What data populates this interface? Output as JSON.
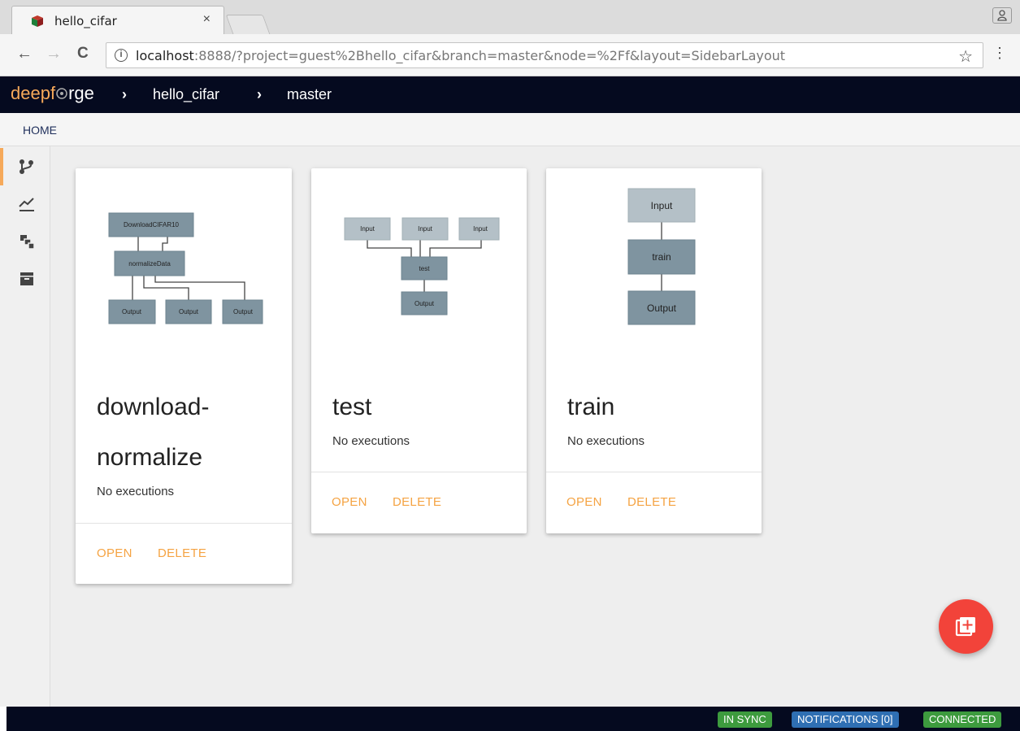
{
  "browser": {
    "tab_title": "hello_cifar",
    "tab_close": "×",
    "profile_icon": "person-icon",
    "url_host": "localhost",
    "url_rest": ":8888/?project=guest%2Bhello_cifar&branch=master&node=%2Ff&layout=SidebarLayout",
    "back": "←",
    "forward": "→",
    "reload": "C",
    "info": "i",
    "star": "☆",
    "menu": "⋮"
  },
  "header": {
    "brand_prefix": "deepf",
    "brand_suffix": "rge",
    "sep": "›",
    "project": "hello_cifar",
    "branch": "master"
  },
  "nav": {
    "home": "HOME"
  },
  "sidebar": {
    "items": [
      {
        "icon": "pipelines-icon",
        "active": true
      },
      {
        "icon": "executions-chart-icon",
        "active": false
      },
      {
        "icon": "layers-icon",
        "active": false
      },
      {
        "icon": "archive-icon",
        "active": false
      }
    ]
  },
  "cards": [
    {
      "title_line1": "download-",
      "title_line2": "normalize",
      "status": "No executions",
      "open": "OPEN",
      "delete": "DELETE",
      "diagram": {
        "top": "DownloadCIFAR10",
        "mid": "normalizeData",
        "out1": "Output",
        "out2": "Output",
        "out3": "Output"
      }
    },
    {
      "title": "test",
      "status": "No executions",
      "open": "OPEN",
      "delete": "DELETE",
      "diagram": {
        "in1": "Input",
        "in2": "Input",
        "in3": "Input",
        "mid": "test",
        "out": "Output"
      }
    },
    {
      "title": "train",
      "status": "No executions",
      "open": "OPEN",
      "delete": "DELETE",
      "diagram": {
        "in": "Input",
        "mid": "train",
        "out": "Output"
      }
    }
  ],
  "footer": {
    "sync": "IN SYNC",
    "notifications": "NOTIFICATIONS [0]",
    "connected": "CONNECTED"
  },
  "colors": {
    "accent": "#f5a342",
    "header_bg": "#050a1f",
    "fab": "#f2433a",
    "badge_green": "#3d9b3e",
    "badge_blue": "#2f6fb3"
  }
}
